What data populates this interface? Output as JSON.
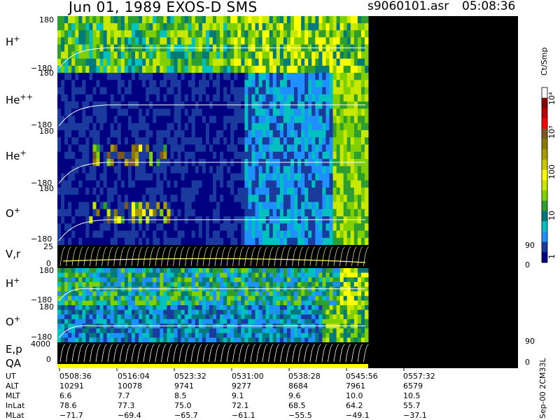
{
  "header": {
    "title": "Jun 01, 1989   EXOS-D SMS",
    "file": "s9060101.asr",
    "time": "05:08:36"
  },
  "colorbar": {
    "unit": "Ct/Smp",
    "tick_labels": [
      "10⁴",
      "10³",
      "100",
      "10",
      "1"
    ],
    "colors": [
      "#ffffff",
      "#8b0000",
      "#c00000",
      "#ff0000",
      "#7a5a20",
      "#8b7a00",
      "#a89a00",
      "#c8c800",
      "#ffff00",
      "#c8e800",
      "#80d000",
      "#2e9e2e",
      "#007a7a",
      "#00c0c0",
      "#1e90ff",
      "#1a3a9e",
      "#000080"
    ]
  },
  "panels": [
    {
      "species": "H",
      "charge": "+",
      "top_tick": "180",
      "bottom_tick": "−180",
      "bg": "#6aaa3a"
    },
    {
      "species": "He",
      "charge": "++",
      "top_tick": "180",
      "bottom_tick": "−180",
      "bg": "#1a2a8a"
    },
    {
      "species": "He",
      "charge": "+",
      "top_tick": "180",
      "bottom_tick": "−180",
      "bg": "#1a2a8a"
    },
    {
      "species": "O",
      "charge": "+",
      "top_tick": "180",
      "bottom_tick": "−180",
      "bg": "#1a2a8a"
    },
    {
      "species": "V,r",
      "charge": "",
      "top_tick": "25",
      "bottom_tick": "0",
      "right_top": "90",
      "right_bottom": "0",
      "bg": "#000000"
    },
    {
      "species": "H",
      "charge": "+",
      "top_tick": "180",
      "bottom_tick": "−180",
      "bg": "#3a7ac0"
    },
    {
      "species": "O",
      "charge": "+",
      "top_tick": "180",
      "bottom_tick": "−180",
      "bg": "#2a4ab0"
    },
    {
      "species": "E,p",
      "charge": "",
      "top_tick": "4000",
      "bottom_tick": "0",
      "right_top": "90",
      "right_bottom": "0",
      "bg": "#000000"
    }
  ],
  "qa_label": "QA",
  "side_note": "Sep-00 2CM33L",
  "footer": {
    "rows": [
      {
        "name": "UT",
        "values": [
          "0508:36",
          "0516:04",
          "0523:32",
          "0531:00",
          "0538:28",
          "0545:56",
          "0557:32"
        ]
      },
      {
        "name": "ALT",
        "values": [
          "10291",
          "10078",
          "9741",
          "9277",
          "8684",
          "7961",
          "6579"
        ]
      },
      {
        "name": "MLT",
        "values": [
          "6.6",
          "7.7",
          "8.5",
          "9.1",
          "9.6",
          "10.0",
          "10.5"
        ]
      },
      {
        "name": "InLat",
        "values": [
          "78.6",
          "77.3",
          "75.0",
          "72.1",
          "68.5",
          "64.2",
          "55.7"
        ]
      },
      {
        "name": "MLat",
        "values": [
          "−71.7",
          "−69.4",
          "−65.7",
          "−61.1",
          "−55.5",
          "−49.1",
          "−37.1"
        ]
      }
    ]
  },
  "chart_data": {
    "type": "heatmap",
    "title": "Jun 01, 1989   EXOS-D SMS",
    "x_label": "UT",
    "x_ticks": [
      "0508:36",
      "0516:04",
      "0523:32",
      "0531:00",
      "0538:28",
      "0545:56",
      "0557:32"
    ],
    "colorbar_unit": "Ct/Smp",
    "panels": [
      "H+",
      "He++",
      "He+",
      "O+",
      "V,r",
      "H+",
      "O+",
      "E,p"
    ],
    "pitch_angle_range": [
      -180,
      180
    ]
  }
}
